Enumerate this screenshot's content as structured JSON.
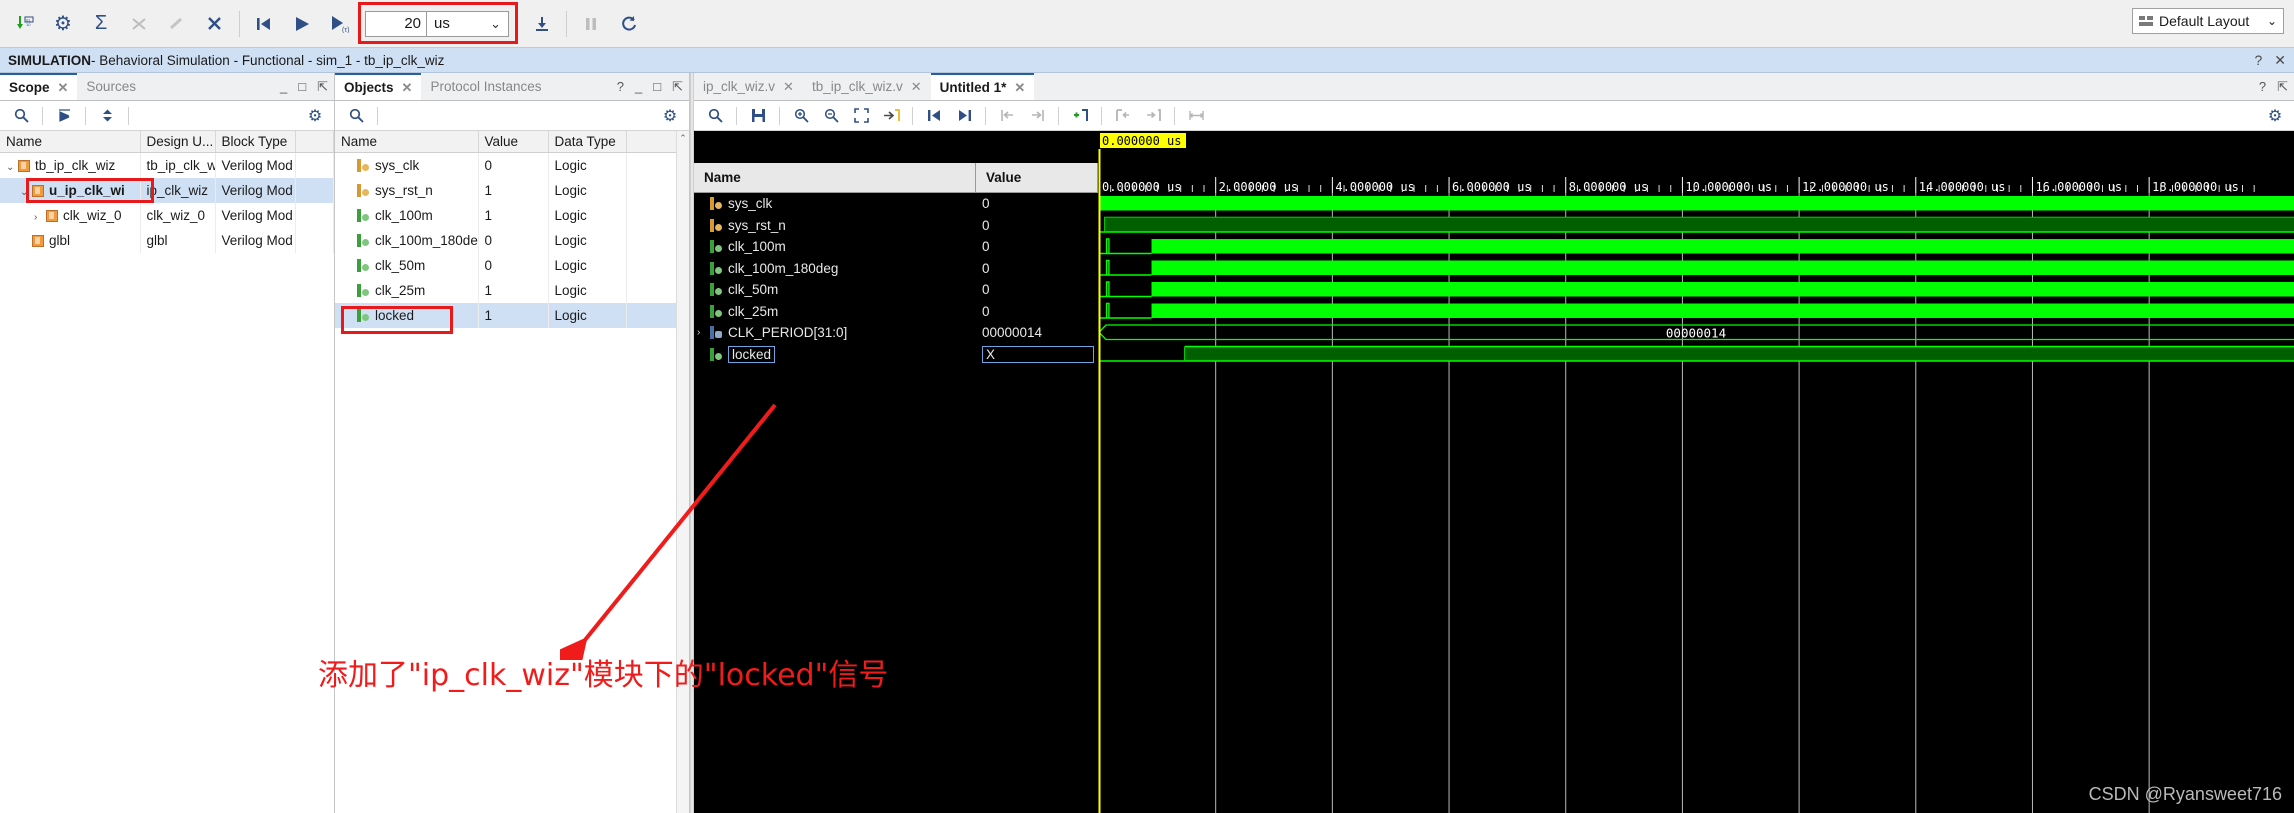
{
  "toolbar": {
    "icons": [
      {
        "name": "step-into-icon",
        "glyph": "⬇",
        "dim": false
      },
      {
        "name": "settings-gear-icon",
        "glyph": "⚙",
        "dim": false
      },
      {
        "name": "relaunch-sigma-icon",
        "glyph": "Σ",
        "dim": false
      },
      {
        "name": "breakpoint-disabled-icon",
        "glyph": "✖",
        "dim": true
      },
      {
        "name": "disable-breakpoints-icon",
        "glyph": "⬳",
        "dim": true
      },
      {
        "name": "remove-breakpoints-icon",
        "glyph": "✗",
        "dim": false
      },
      {
        "name": "restart-icon",
        "glyph": "|◀",
        "dim": false
      },
      {
        "name": "run-all-icon",
        "glyph": "▶",
        "dim": false
      },
      {
        "name": "run-for-time-icon",
        "glyph": "▶₍ₜ₎",
        "dim": false
      }
    ],
    "run_time_value": "20",
    "run_time_unit": "us",
    "after_icons": [
      {
        "name": "step-icon",
        "glyph": "⤓",
        "dim": false
      },
      {
        "name": "pause-icon",
        "glyph": "❚❚",
        "dim": true
      },
      {
        "name": "restart-simulation-icon",
        "glyph": "⟳",
        "dim": false
      }
    ],
    "layout_label": "Default Layout"
  },
  "simbar": {
    "prefix": "SIMULATION",
    "text": " - Behavioral Simulation - Functional - sim_1 - tb_ip_clk_wiz",
    "help_icon": "?",
    "close_icon": "✕"
  },
  "scope_panel": {
    "tabs": [
      {
        "label": "Scope",
        "active": true,
        "closable": true
      },
      {
        "label": "Sources",
        "active": false,
        "closable": false
      }
    ],
    "toolbar_icons": [
      {
        "name": "search-icon",
        "glyph": "🔍"
      },
      {
        "name": "collapse-all-icon",
        "glyph": "⇤"
      },
      {
        "name": "expand-all-icon",
        "glyph": "⇕"
      }
    ],
    "settings_icon": "⚙",
    "columns": [
      "Name",
      "Design U...",
      "Block Type"
    ],
    "rows": [
      {
        "indent": 0,
        "arrow": "v",
        "name": "tb_ip_clk_wiz",
        "design_unit": "tb_ip_clk_wi",
        "block_type": "Verilog Mod",
        "selected": false,
        "bold": false,
        "highlight": false
      },
      {
        "indent": 1,
        "arrow": "v",
        "name": "u_ip_clk_wi",
        "design_unit": "ip_clk_wiz",
        "block_type": "Verilog Mod",
        "selected": true,
        "bold": true,
        "highlight": true
      },
      {
        "indent": 2,
        "arrow": ">",
        "name": "clk_wiz_0",
        "design_unit": "clk_wiz_0",
        "block_type": "Verilog Mod",
        "selected": false,
        "bold": false,
        "highlight": false
      },
      {
        "indent": 1,
        "arrow": "",
        "name": "glbl",
        "design_unit": "glbl",
        "block_type": "Verilog Mod",
        "selected": false,
        "bold": false,
        "highlight": false
      }
    ]
  },
  "objects_panel": {
    "tabs": [
      {
        "label": "Objects",
        "active": true,
        "closable": true
      },
      {
        "label": "Protocol Instances",
        "active": false,
        "closable": false
      }
    ],
    "window_icons": [
      "?",
      "_",
      "□",
      "⇱"
    ],
    "search_icon": "🔍",
    "settings_icon": "⚙",
    "columns": [
      "Name",
      "Value",
      "Data Type"
    ],
    "rows": [
      {
        "icon": "in",
        "name": "sys_clk",
        "value": "0",
        "data_type": "Logic",
        "selected": false,
        "highlight": false
      },
      {
        "icon": "in",
        "name": "sys_rst_n",
        "value": "1",
        "data_type": "Logic",
        "selected": false,
        "highlight": false
      },
      {
        "icon": "out",
        "name": "clk_100m",
        "value": "1",
        "data_type": "Logic",
        "selected": false,
        "highlight": false
      },
      {
        "icon": "out",
        "name": "clk_100m_180de",
        "value": "0",
        "data_type": "Logic",
        "selected": false,
        "highlight": false
      },
      {
        "icon": "out",
        "name": "clk_50m",
        "value": "0",
        "data_type": "Logic",
        "selected": false,
        "highlight": false
      },
      {
        "icon": "out",
        "name": "clk_25m",
        "value": "1",
        "data_type": "Logic",
        "selected": false,
        "highlight": false
      },
      {
        "icon": "out",
        "name": "locked",
        "value": "1",
        "data_type": "Logic",
        "selected": true,
        "highlight": true
      }
    ]
  },
  "wave_panel": {
    "tabs": [
      {
        "label": "ip_clk_wiz.v",
        "active": false
      },
      {
        "label": "tb_ip_clk_wiz.v",
        "active": false
      },
      {
        "label": "Untitled 1*",
        "active": true
      }
    ],
    "window_icons": [
      "?",
      "⇱"
    ],
    "settings_icon": "⚙",
    "toolbar_icons": [
      {
        "name": "search-icon",
        "glyph": "🔍",
        "dim": false
      },
      {
        "name": "save-waveform-icon",
        "glyph": "💾",
        "dim": false
      },
      {
        "name": "zoom-in-icon",
        "glyph": "⊕",
        "dim": false
      },
      {
        "name": "zoom-out-icon",
        "glyph": "⊖",
        "dim": false
      },
      {
        "name": "zoom-fit-icon",
        "glyph": "⤢",
        "dim": false
      },
      {
        "name": "go-to-time-icon",
        "glyph": "→|",
        "dim": false
      },
      {
        "name": "go-to-start-icon",
        "glyph": "|◀",
        "dim": false
      },
      {
        "name": "go-to-end-icon",
        "glyph": "▶|",
        "dim": false
      },
      {
        "name": "previous-transition-icon",
        "glyph": "⇤",
        "dim": true
      },
      {
        "name": "next-transition-icon",
        "glyph": "⇥",
        "dim": true
      },
      {
        "name": "add-marker-icon",
        "glyph": "+|",
        "dim": false
      },
      {
        "name": "previous-marker-icon",
        "glyph": "|←",
        "dim": true
      },
      {
        "name": "next-marker-icon",
        "glyph": "→|",
        "dim": true
      },
      {
        "name": "measure-time-icon",
        "glyph": "|↔|",
        "dim": true
      }
    ],
    "columns": [
      "Name",
      "Value"
    ],
    "cursor_label": "0.000000 us",
    "time_ticks": [
      "0.000000 us",
      "2.000000 us",
      "4.000000 us",
      "6.000000 us",
      "8.000000 us",
      "10.000000 us",
      "12.000000 us",
      "14.000000 us",
      "16.000000 us",
      "18.000000 us"
    ],
    "rows": [
      {
        "icon": "in",
        "name": "sys_clk",
        "value": "0",
        "expandable": false,
        "selected": false,
        "wave": "clock-fast"
      },
      {
        "icon": "in",
        "name": "sys_rst_n",
        "value": "0",
        "expandable": false,
        "selected": false,
        "wave": "rst"
      },
      {
        "icon": "out",
        "name": "clk_100m",
        "value": "0",
        "expandable": false,
        "selected": false,
        "wave": "clk-delayed"
      },
      {
        "icon": "out",
        "name": "clk_100m_180deg",
        "value": "0",
        "expandable": false,
        "selected": false,
        "wave": "clk-delayed"
      },
      {
        "icon": "out",
        "name": "clk_50m",
        "value": "0",
        "expandable": false,
        "selected": false,
        "wave": "clk-delayed"
      },
      {
        "icon": "out",
        "name": "clk_25m",
        "value": "0",
        "expandable": false,
        "selected": false,
        "wave": "clk-delayed"
      },
      {
        "icon": "arr",
        "name": "CLK_PERIOD[31:0]",
        "value": "00000014",
        "expandable": true,
        "selected": false,
        "wave": "bus",
        "bus_value": "00000014"
      },
      {
        "icon": "out",
        "name": "locked",
        "value": "X",
        "expandable": false,
        "selected": true,
        "wave": "locked"
      }
    ]
  },
  "annotation": {
    "text": "添加了\"ip_clk_wiz\"模块下的\"locked\"信号",
    "color": "#f01c1c"
  },
  "watermark": "CSDN @Ryansweet716"
}
